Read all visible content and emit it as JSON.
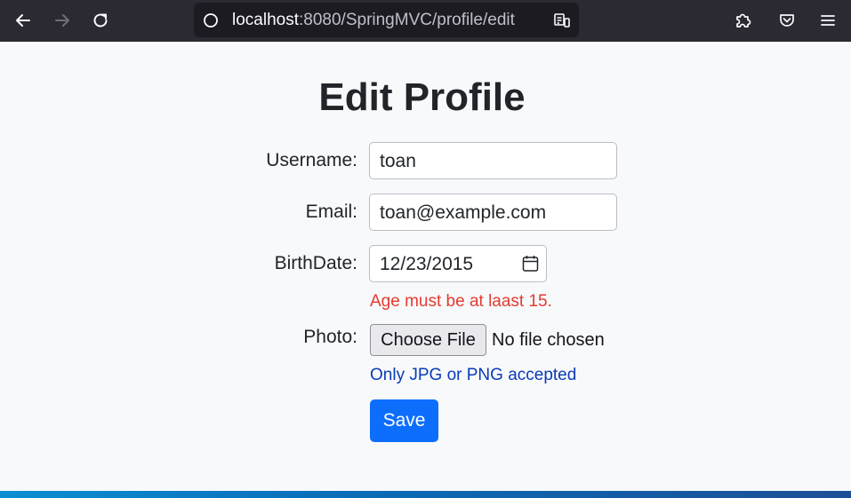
{
  "browser": {
    "url_host": "localhost",
    "url_rest": ":8080/SpringMVC/profile/edit"
  },
  "page": {
    "title": "Edit Profile"
  },
  "form": {
    "username": {
      "label": "Username:",
      "value": "toan"
    },
    "email": {
      "label": "Email:",
      "value": "toan@example.com"
    },
    "birthdate": {
      "label": "BirthDate:",
      "value": "12/23/2015",
      "error": "Age must be at laast 15."
    },
    "photo": {
      "label": "Photo:",
      "button_label": "Choose File",
      "status": "No file chosen",
      "hint": "Only JPG or PNG accepted"
    },
    "save_label": "Save"
  },
  "colors": {
    "error": "#e53a2f",
    "hint": "#0a3bb5",
    "primary": "#0d6efd"
  }
}
